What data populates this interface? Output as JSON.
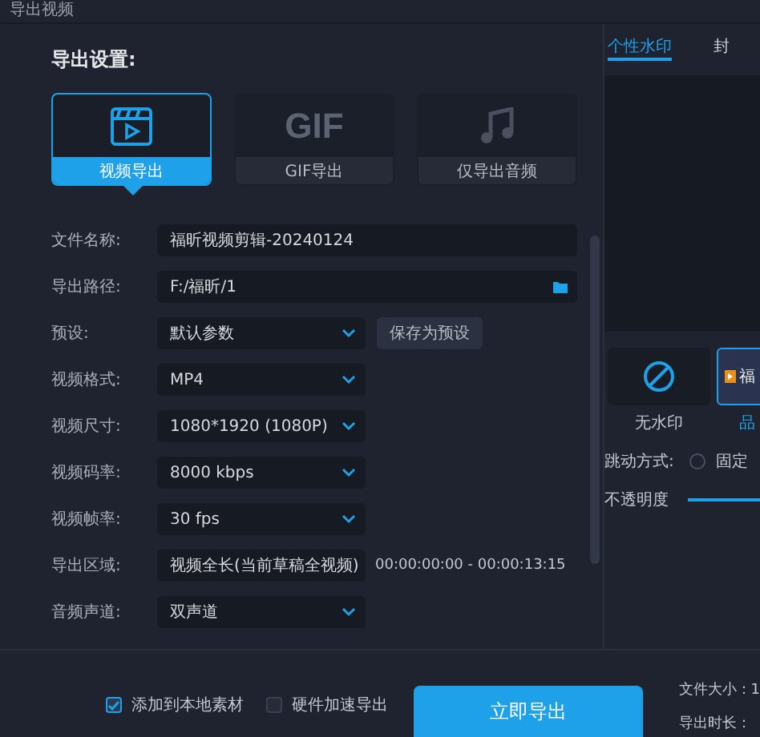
{
  "window": {
    "title": "导出视频"
  },
  "section_title": "导出设置:",
  "export_modes": [
    {
      "kind": "video",
      "label": "视频导出",
      "selected": true
    },
    {
      "kind": "gif",
      "icon_text": "GIF",
      "label": "GIF导出",
      "selected": false
    },
    {
      "kind": "audio",
      "label": "仅导出音频",
      "selected": false
    }
  ],
  "fields": [
    {
      "kind": "text",
      "label": "文件名称:",
      "value": "福昕视频剪辑-20240124"
    },
    {
      "kind": "path",
      "label": "导出路径:",
      "value": "F:/福昕/1"
    },
    {
      "kind": "select",
      "label": "预设:",
      "value": "默认参数",
      "button": "保存为预设"
    },
    {
      "kind": "select",
      "label": "视频格式:",
      "value": "MP4"
    },
    {
      "kind": "select",
      "label": "视频尺寸:",
      "value": "1080*1920 (1080P)"
    },
    {
      "kind": "select",
      "label": "视频码率:",
      "value": "8000 kbps"
    },
    {
      "kind": "select",
      "label": "视频帧率:",
      "value": "30 fps"
    },
    {
      "kind": "select",
      "label": "导出区域:",
      "value": "视频全长(当前草稿全视频)",
      "note": "00:00:00:00 - 00:00:13:15"
    },
    {
      "kind": "select",
      "label": "音频声道:",
      "value": "双声道"
    }
  ],
  "side_tabs": [
    {
      "label": "个性水印",
      "selected": true
    },
    {
      "label": "封",
      "selected": false
    }
  ],
  "watermarks": [
    {
      "kind": "none",
      "label": "无水印",
      "selected": false
    },
    {
      "kind": "brand",
      "badge": "福",
      "label": "品",
      "selected": true
    }
  ],
  "motion": {
    "label": "跳动方式:",
    "option": {
      "label": "固定",
      "selected": false
    }
  },
  "opacity": {
    "label": "不透明度",
    "level": 1
  },
  "options": [
    {
      "label": "添加到本地素材",
      "checked": true
    },
    {
      "label": "硬件加速导出",
      "checked": false
    }
  ],
  "export_button": "立即导出",
  "info": [
    "文件大小：1",
    "导出时长："
  ]
}
